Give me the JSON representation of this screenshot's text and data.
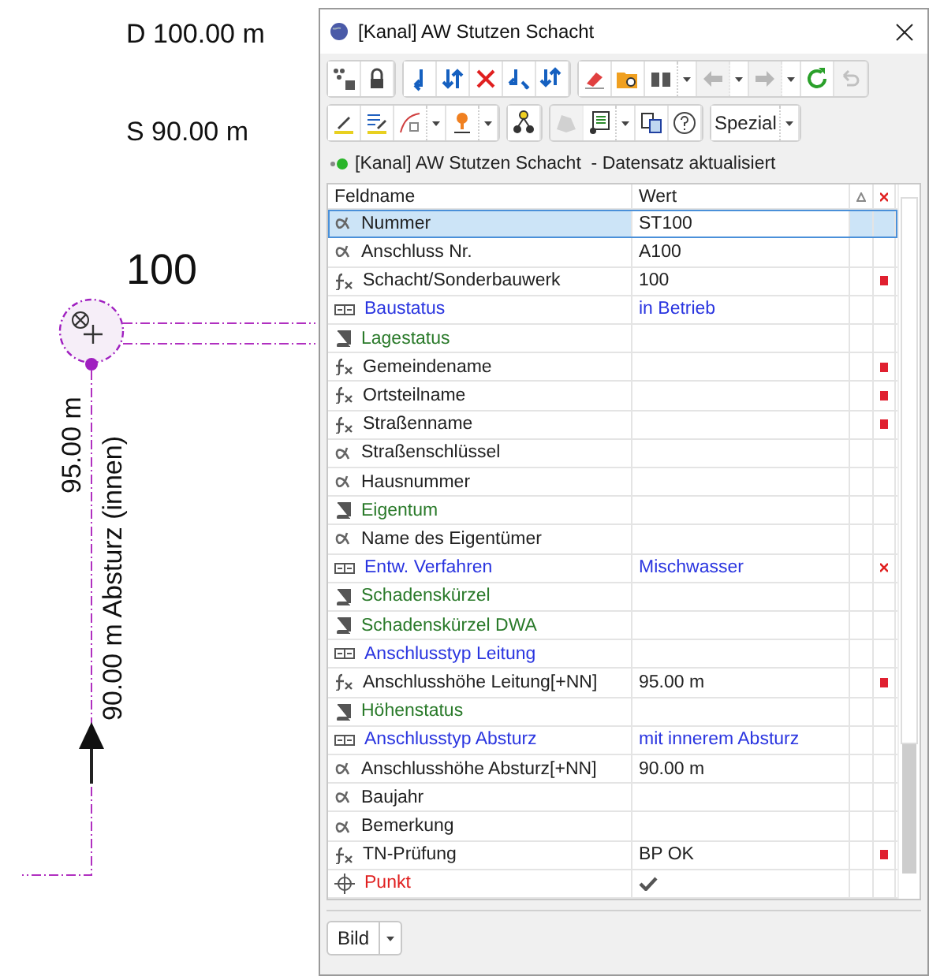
{
  "canvas": {
    "labels": [
      {
        "kind": "depth",
        "text": "D 100.00 m"
      },
      {
        "kind": "bottom",
        "text": "S 90.00 m"
      },
      {
        "kind": "number",
        "text": "100"
      },
      {
        "kind": "height",
        "text": "95.00 m"
      },
      {
        "kind": "drop",
        "text": "90.00 m Absturz (innen)"
      }
    ]
  },
  "window": {
    "title": "[Kanal] AW Stutzen Schacht"
  },
  "toolbar": {
    "rows": [
      [
        [
          {
            "kind": "icon",
            "disabled": false,
            "dropdown": false
          },
          {
            "kind": "icon",
            "disabled": false,
            "dropdown": false
          }
        ],
        [
          {
            "kind": "icon",
            "disabled": false,
            "dropdown": false
          },
          {
            "kind": "icon",
            "disabled": false,
            "dropdown": false
          },
          {
            "kind": "icon",
            "disabled": false,
            "dropdown": false
          },
          {
            "kind": "icon",
            "disabled": false,
            "dropdown": false
          },
          {
            "kind": "icon",
            "disabled": false,
            "dropdown": false
          }
        ],
        [
          {
            "kind": "icon",
            "disabled": false,
            "dropdown": false
          },
          {
            "kind": "icon",
            "disabled": false,
            "dropdown": false
          },
          {
            "kind": "icon",
            "disabled": false,
            "dropdown": true
          },
          {
            "kind": "icon",
            "disabled": true,
            "dropdown": true
          },
          {
            "kind": "icon",
            "disabled": true,
            "dropdown": true
          },
          {
            "kind": "icon",
            "disabled": false,
            "dropdown": false
          },
          {
            "kind": "icon",
            "disabled": true,
            "dropdown": false
          }
        ]
      ],
      [
        [
          {
            "kind": "icon",
            "disabled": false,
            "dropdown": false
          },
          {
            "kind": "icon",
            "disabled": false,
            "dropdown": false
          },
          {
            "kind": "icon",
            "disabled": false,
            "dropdown": true
          },
          {
            "kind": "icon",
            "disabled": false,
            "dropdown": true
          }
        ],
        [
          {
            "kind": "icon",
            "disabled": false,
            "dropdown": false
          }
        ],
        [
          {
            "kind": "icon",
            "disabled": true,
            "dropdown": false
          },
          {
            "kind": "icon",
            "disabled": false,
            "dropdown": true
          },
          {
            "kind": "icon",
            "disabled": false,
            "dropdown": false
          },
          {
            "kind": "icon",
            "disabled": false,
            "dropdown": false
          }
        ],
        [
          {
            "kind": "text",
            "label": "Spezial",
            "disabled": false,
            "dropdown": true
          }
        ]
      ]
    ]
  },
  "status": {
    "ok": true,
    "text": "[Kanal] AW Stutzen Schacht  - Datensatz aktualisiert"
  },
  "table": {
    "columns": [
      {
        "kind": "text",
        "label": "Feldname"
      },
      {
        "kind": "text",
        "label": "Wert"
      },
      {
        "kind": "delta"
      },
      {
        "kind": "required"
      }
    ],
    "rows": [
      {
        "kind": "alpha",
        "name": "Nummer",
        "value": "ST100",
        "selected": true,
        "required": false,
        "error": false
      },
      {
        "kind": "alpha",
        "name": "Anschluss Nr.",
        "value": "A100",
        "selected": false,
        "required": false,
        "error": false
      },
      {
        "kind": "formula",
        "name": "Schacht/Sonderbauwerk",
        "value": "100",
        "selected": false,
        "required": true,
        "error": false
      },
      {
        "kind": "list",
        "name": "Baustatus",
        "value": "in Betrieb",
        "selected": false,
        "required": false,
        "error": false
      },
      {
        "kind": "book",
        "name": "Lagestatus",
        "selected": false,
        "required": false,
        "error": false
      },
      {
        "kind": "formula",
        "name": "Gemeindename",
        "selected": false,
        "required": true,
        "error": false
      },
      {
        "kind": "formula",
        "name": "Ortsteilname",
        "selected": false,
        "required": true,
        "error": false
      },
      {
        "kind": "formula",
        "name": "Straßenname",
        "selected": false,
        "required": true,
        "error": false
      },
      {
        "kind": "alpha",
        "name": "Straßenschlüssel",
        "selected": false,
        "required": false,
        "error": false
      },
      {
        "kind": "alpha",
        "name": "Hausnummer",
        "selected": false,
        "required": false,
        "error": false
      },
      {
        "kind": "book",
        "name": "Eigentum",
        "selected": false,
        "required": false,
        "error": false
      },
      {
        "kind": "alpha",
        "name": "Name des Eigentümer",
        "selected": false,
        "required": false,
        "error": false
      },
      {
        "kind": "list",
        "name": "Entw. Verfahren",
        "value": "Mischwasser",
        "selected": false,
        "required": false,
        "error": true
      },
      {
        "kind": "book",
        "name": "Schadenskürzel",
        "selected": false,
        "required": false,
        "error": false
      },
      {
        "kind": "book",
        "name": "Schadenskürzel DWA",
        "selected": false,
        "required": false,
        "error": false
      },
      {
        "kind": "list",
        "name": "Anschlusstyp Leitung",
        "selected": false,
        "required": false,
        "error": false
      },
      {
        "kind": "formula",
        "name": "Anschlusshöhe Leitung[+NN]",
        "value": "95.00 m",
        "selected": false,
        "required": true,
        "error": false
      },
      {
        "kind": "book",
        "name": "Höhenstatus",
        "selected": false,
        "required": false,
        "error": false
      },
      {
        "kind": "list",
        "name": "Anschlusstyp Absturz",
        "value": "mit innerem Absturz",
        "selected": false,
        "required": false,
        "error": false
      },
      {
        "kind": "alpha",
        "name": "Anschlusshöhe Absturz[+NN]",
        "value": "90.00 m",
        "selected": false,
        "required": false,
        "error": false
      },
      {
        "kind": "alpha",
        "name": "Baujahr",
        "selected": false,
        "required": false,
        "error": false
      },
      {
        "kind": "alpha",
        "name": "Bemerkung",
        "selected": false,
        "required": false,
        "error": false
      },
      {
        "kind": "formula",
        "name": "TN-Prüfung",
        "value": "BP OK",
        "selected": false,
        "required": true,
        "error": false
      },
      {
        "kind": "point",
        "name": "Punkt",
        "checked": true,
        "selected": false,
        "required": false,
        "error": false
      }
    ]
  },
  "footer": {
    "button": {
      "label": "Bild",
      "dropdown": true
    }
  }
}
